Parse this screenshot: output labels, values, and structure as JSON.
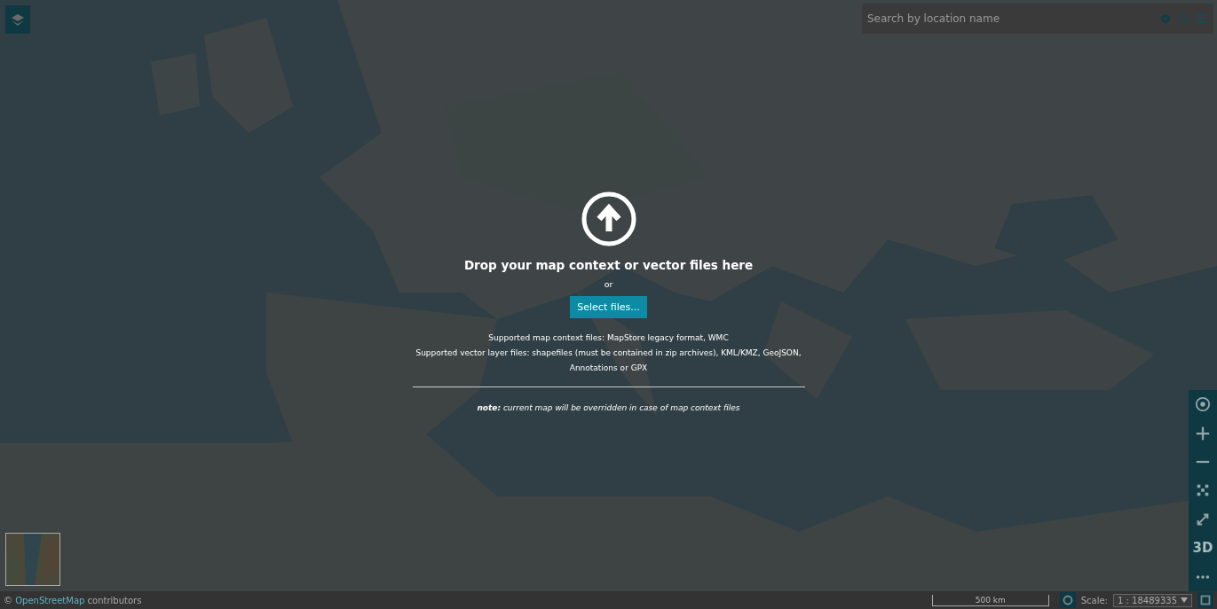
{
  "search": {
    "placeholder": "Search by location name"
  },
  "drop_zone": {
    "title": "Drop your map context or vector files here",
    "or": "or",
    "button": "Select files...",
    "supported": [
      "Supported map context files: MapStore legacy format, WMC",
      "Supported vector layer files: shapefiles (must be contained in zip archives), KML/KMZ, GeoJSON, Annotations or GPX"
    ],
    "note": "**note:** current map will be overridden in case of map context files"
  },
  "map_toolbar": {
    "label_3d": "3D"
  },
  "footer": {
    "attribution_prefix": "©",
    "attribution_link": "OpenStreetMap",
    "attribution_suffix": "contributors",
    "scale_bar": "500 km",
    "scale_label": "Scale:",
    "scale_value": "1 : 18489335"
  }
}
